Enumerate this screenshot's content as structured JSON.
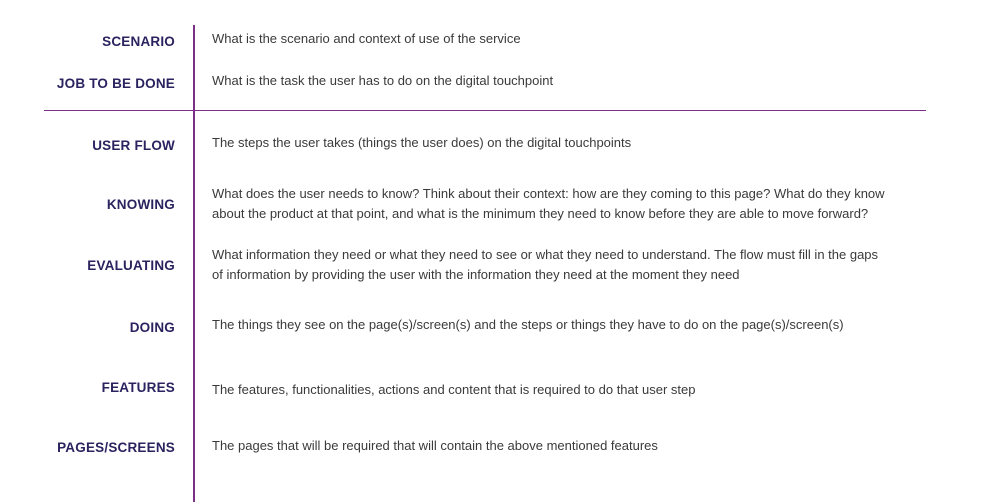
{
  "rows": [
    {
      "label": "SCENARIO",
      "lines": [
        "What is the scenario and context of use of the service"
      ]
    },
    {
      "label": "JOB TO BE DONE",
      "lines": [
        "What is the task the user has to do on the digital touchpoint"
      ]
    },
    {
      "label": "USER FLOW",
      "lines": [
        "The steps the user takes (things the user does) on the digital touchpoints"
      ]
    },
    {
      "label": "KNOWING",
      "lines": [
        "What does the user needs to know? Think about their context: how are they coming to this page? What do they know",
        "about the product at that point, and what is the minimum they need to know before they are able to move forward?"
      ]
    },
    {
      "label": "EVALUATING",
      "lines": [
        "What information they need or what they need to see or what they need to understand. The flow must fill in the gaps",
        " of information by providing the user with the information they need at the moment they need"
      ]
    },
    {
      "label": "DOING",
      "lines": [
        "The things they see on the page(s)/screen(s) and the steps or things they have to do on the page(s)/screen(s)"
      ]
    },
    {
      "label": "FEATURES",
      "lines": [
        "The features, functionalities, actions and content that is required to do that user step"
      ]
    },
    {
      "label": "PAGES/SCREENS",
      "lines": [
        "The pages that will be required that will contain the above mentioned features"
      ]
    }
  ],
  "colors": {
    "label": "#2a235f",
    "text": "#3a3a3a",
    "divider": "#7b2f86"
  }
}
